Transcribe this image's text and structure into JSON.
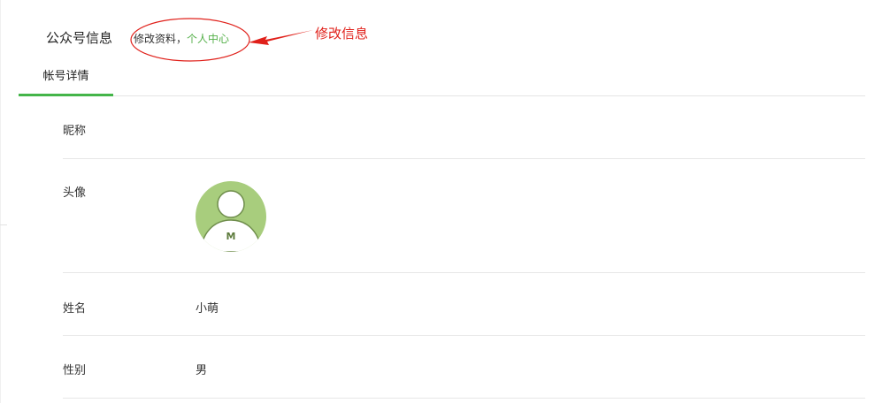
{
  "header": {
    "title": "公众号信息",
    "edit_prefix": "修改资料，",
    "edit_link": "个人中心"
  },
  "annotation": {
    "label": "修改信息",
    "color": "#e0201a"
  },
  "tabs": [
    {
      "label": "帐号详情",
      "active": true
    }
  ],
  "details": {
    "nickname": {
      "label": "昵称",
      "value": ""
    },
    "avatar": {
      "label": "头像",
      "icon": "user-avatar-icon",
      "badge": "M"
    },
    "name": {
      "label": "姓名",
      "value": "小萌"
    },
    "gender": {
      "label": "性别",
      "value": "男"
    }
  },
  "colors": {
    "accent": "#44b549",
    "link": "#55b04a",
    "avatar_bg": "#a8cd7d"
  }
}
